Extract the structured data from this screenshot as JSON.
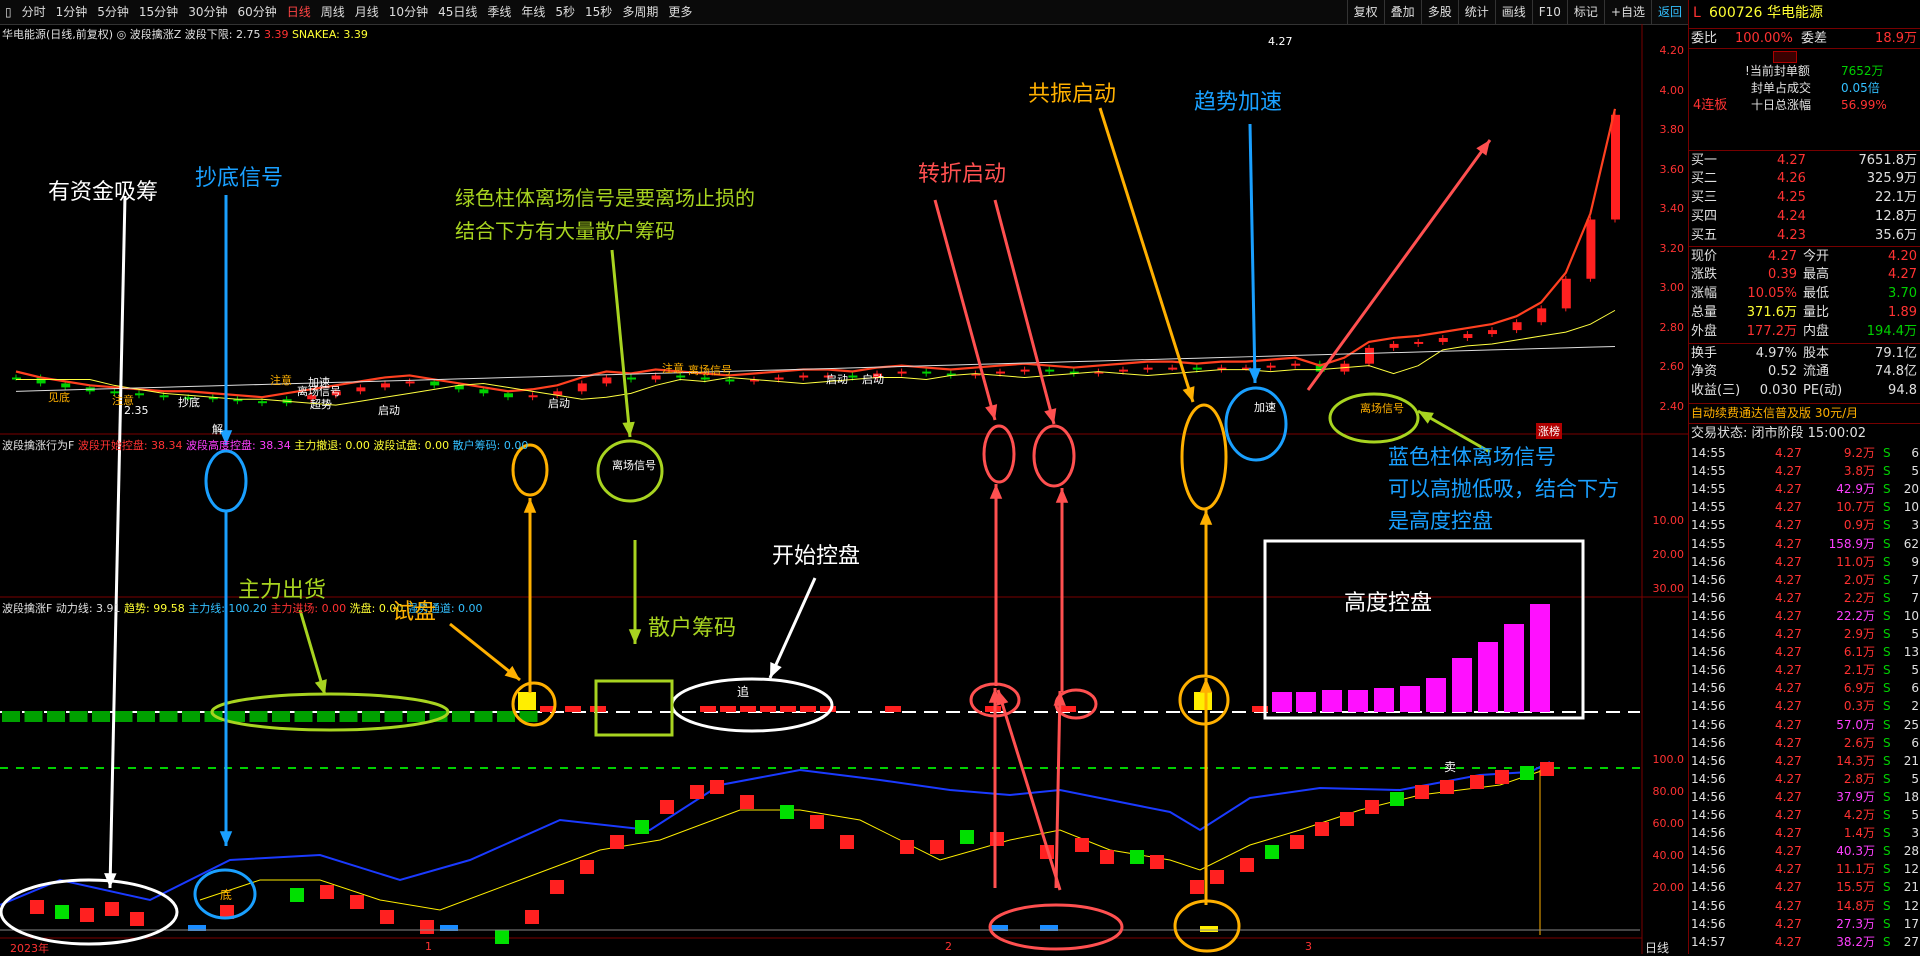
{
  "toolbar": {
    "tabs": [
      "分时",
      "1分钟",
      "5分钟",
      "15分钟",
      "30分钟",
      "60分钟",
      "日线",
      "周线",
      "月线",
      "10分钟",
      "45日线",
      "季线",
      "年线",
      "5秒",
      "15秒",
      "多周期",
      "更多"
    ],
    "active_tab": "日线",
    "tools": [
      "复权",
      "叠加",
      "多股",
      "统计",
      "画线",
      "F10",
      "标记",
      "+自选",
      "返回"
    ]
  },
  "main_panel": {
    "header": {
      "title": "华电能源(日线,前复权)",
      "indicator": "波段擒涨Z",
      "lower_label": "波段下限: 2.75",
      "extra_value": "3.39",
      "snake_label": "SNAKEA: 3.39"
    },
    "axis": [
      "4.20",
      "4.00",
      "3.80",
      "3.60",
      "3.40",
      "3.20",
      "3.00",
      "2.80",
      "2.60",
      "2.40"
    ],
    "price_tags": {
      "high": "4.27",
      "low": "2.35"
    },
    "labels": {
      "jiemian": "见底",
      "zhuyi1": "注意",
      "zhuyi2": "注意",
      "zhuyi3": "注意",
      "chaodi": "抄底",
      "lichang1": "离场信号",
      "lichang2": "离场信号",
      "jiasu_small": "加速",
      "chaoshi": "超势",
      "qidong1": "启动",
      "qidong2": "启动",
      "qidong3": "启动",
      "qidong4": "启动",
      "jiesuo": "解",
      "zhangbang": "涨榜"
    }
  },
  "mid_panel": {
    "header": {
      "name": "波段擒涨行为F",
      "start_ctrl": "波段开始控盘: 38.34",
      "high_ctrl": "波段高度控盘: 38.34",
      "main_retreat": "主力撤退: 0.00",
      "trial": "波段试盘: 0.00",
      "retail": "散户筹码: 0.00"
    },
    "axis": [
      "30.00",
      "20.00",
      "10.00"
    ]
  },
  "bot_panel": {
    "header": {
      "name": "波段擒涨F",
      "power": "动力线: 3.91",
      "trend": "趋势: 99.58",
      "main_line": "主力线: 100.20",
      "entry": "主力进场: 0.00",
      "wash": "洗盘: 0.00",
      "zone": "强势通道: 0.00"
    },
    "axis": [
      "100.0",
      "80.00",
      "60.00",
      "40.00",
      "20.00"
    ],
    "labels": {
      "zhui": "追",
      "di": "底",
      "mai": "卖"
    },
    "bottom_axis": [
      "2023年",
      "1",
      "2",
      "3"
    ],
    "period": "日线"
  },
  "annotations": {
    "accumulate": "有资金吸筹",
    "bottom_signal": "抄底信号",
    "green_exit_1": "绿色柱体离场信号是要离场止损的",
    "green_exit_2": "结合下方有大量散户筹码",
    "turn_start": "转折启动",
    "resonance": "共振启动",
    "trend_accel": "趋势加速",
    "main_sell": "主力出货",
    "trial": "试盘",
    "retail_chips": "散户筹码",
    "start_control": "开始控盘",
    "high_control": "高度控盘",
    "blue_exit_1": "蓝色柱体离场信号",
    "blue_exit_2": "可以高抛低吸，结合下方",
    "blue_exit_3": "是高度控盘",
    "accel_badge": "加速",
    "exit_badge": "离场信号",
    "start_badge": "启动"
  },
  "quote": {
    "prefix": "L",
    "code": "600726",
    "name": "华电能源",
    "weibi_label": "委比",
    "weibi": "100.00%",
    "weicha_label": "委差",
    "weicha": "18.9万",
    "seal1_label": "当前封单额",
    "seal1": "7652万",
    "seal2_label": "封单占成交",
    "seal2": "0.05倍",
    "seal3_label": "十日总涨幅",
    "seal3": "56.99%",
    "streak": "4连板",
    "bids": [
      {
        "label": "买一",
        "price": "4.27",
        "vol": "7651.8万"
      },
      {
        "label": "买二",
        "price": "4.26",
        "vol": "325.9万"
      },
      {
        "label": "买三",
        "price": "4.25",
        "vol": "22.1万"
      },
      {
        "label": "买四",
        "price": "4.24",
        "vol": "12.8万"
      },
      {
        "label": "买五",
        "price": "4.23",
        "vol": "35.6万"
      }
    ],
    "stats": [
      {
        "l1": "现价",
        "v1": "4.27",
        "c1": "red",
        "l2": "今开",
        "v2": "4.20",
        "c2": "red"
      },
      {
        "l1": "涨跌",
        "v1": "0.39",
        "c1": "red",
        "l2": "最高",
        "v2": "4.27",
        "c2": "red"
      },
      {
        "l1": "涨幅",
        "v1": "10.05%",
        "c1": "red",
        "l2": "最低",
        "v2": "3.70",
        "c2": "grn"
      },
      {
        "l1": "总量",
        "v1": "371.6万",
        "c1": "yel",
        "l2": "量比",
        "v2": "1.89",
        "c2": "red"
      },
      {
        "l1": "外盘",
        "v1": "177.2万",
        "c1": "red",
        "l2": "内盘",
        "v2": "194.4万",
        "c2": "grn"
      }
    ],
    "stats2": [
      {
        "l1": "换手",
        "v1": "4.97%",
        "l2": "股本",
        "v2": "79.1亿"
      },
      {
        "l1": "净资",
        "v1": "0.52",
        "l2": "流通",
        "v2": "74.8亿"
      },
      {
        "l1": "收益(三)",
        "v1": "0.030",
        "l2": "PE(动)",
        "v2": "94.8"
      }
    ],
    "ad": "自动续费通达信普及版  30元/月",
    "trade_status": "交易状态: 闭市阶段 15:00:02",
    "ticks": [
      {
        "t": "14:55",
        "p": "4.27",
        "v": "9.2万",
        "d": "S",
        "n": "6",
        "c": "red"
      },
      {
        "t": "14:55",
        "p": "4.27",
        "v": "3.8万",
        "d": "S",
        "n": "5",
        "c": "red"
      },
      {
        "t": "14:55",
        "p": "4.27",
        "v": "42.9万",
        "d": "S",
        "n": "20",
        "c": "mag"
      },
      {
        "t": "14:55",
        "p": "4.27",
        "v": "10.7万",
        "d": "S",
        "n": "10",
        "c": "red"
      },
      {
        "t": "14:55",
        "p": "4.27",
        "v": "0.9万",
        "d": "S",
        "n": "3",
        "c": "red"
      },
      {
        "t": "14:55",
        "p": "4.27",
        "v": "158.9万",
        "d": "S",
        "n": "62",
        "c": "mag"
      },
      {
        "t": "14:56",
        "p": "4.27",
        "v": "11.0万",
        "d": "S",
        "n": "9",
        "c": "red"
      },
      {
        "t": "14:56",
        "p": "4.27",
        "v": "2.0万",
        "d": "S",
        "n": "7",
        "c": "red"
      },
      {
        "t": "14:56",
        "p": "4.27",
        "v": "2.2万",
        "d": "S",
        "n": "7",
        "c": "red"
      },
      {
        "t": "14:56",
        "p": "4.27",
        "v": "22.2万",
        "d": "S",
        "n": "10",
        "c": "mag"
      },
      {
        "t": "14:56",
        "p": "4.27",
        "v": "2.9万",
        "d": "S",
        "n": "5",
        "c": "red"
      },
      {
        "t": "14:56",
        "p": "4.27",
        "v": "6.1万",
        "d": "S",
        "n": "13",
        "c": "red"
      },
      {
        "t": "14:56",
        "p": "4.27",
        "v": "2.1万",
        "d": "S",
        "n": "5",
        "c": "red"
      },
      {
        "t": "14:56",
        "p": "4.27",
        "v": "6.9万",
        "d": "S",
        "n": "6",
        "c": "red"
      },
      {
        "t": "14:56",
        "p": "4.27",
        "v": "0.3万",
        "d": "S",
        "n": "2",
        "c": "red"
      },
      {
        "t": "14:56",
        "p": "4.27",
        "v": "57.0万",
        "d": "S",
        "n": "25",
        "c": "mag"
      },
      {
        "t": "14:56",
        "p": "4.27",
        "v": "2.6万",
        "d": "S",
        "n": "6",
        "c": "red"
      },
      {
        "t": "14:56",
        "p": "4.27",
        "v": "14.3万",
        "d": "S",
        "n": "21",
        "c": "red"
      },
      {
        "t": "14:56",
        "p": "4.27",
        "v": "2.8万",
        "d": "S",
        "n": "5",
        "c": "red"
      },
      {
        "t": "14:56",
        "p": "4.27",
        "v": "37.9万",
        "d": "S",
        "n": "18",
        "c": "mag"
      },
      {
        "t": "14:56",
        "p": "4.27",
        "v": "4.2万",
        "d": "S",
        "n": "5",
        "c": "red"
      },
      {
        "t": "14:56",
        "p": "4.27",
        "v": "1.4万",
        "d": "S",
        "n": "3",
        "c": "red"
      },
      {
        "t": "14:56",
        "p": "4.27",
        "v": "40.3万",
        "d": "S",
        "n": "28",
        "c": "mag"
      },
      {
        "t": "14:56",
        "p": "4.27",
        "v": "11.1万",
        "d": "S",
        "n": "12",
        "c": "red"
      },
      {
        "t": "14:56",
        "p": "4.27",
        "v": "15.5万",
        "d": "S",
        "n": "21",
        "c": "red"
      },
      {
        "t": "14:56",
        "p": "4.27",
        "v": "14.8万",
        "d": "S",
        "n": "12",
        "c": "red"
      },
      {
        "t": "14:56",
        "p": "4.27",
        "v": "27.3万",
        "d": "S",
        "n": "17",
        "c": "mag"
      },
      {
        "t": "14:57",
        "p": "4.27",
        "v": "38.2万",
        "d": "S",
        "n": "27",
        "c": "mag"
      }
    ]
  },
  "colors": {
    "up": "#ff2020",
    "down": "#00d000",
    "accent": "#ffb000",
    "blue": "#1a8cff",
    "magenta": "#ff20ff"
  }
}
